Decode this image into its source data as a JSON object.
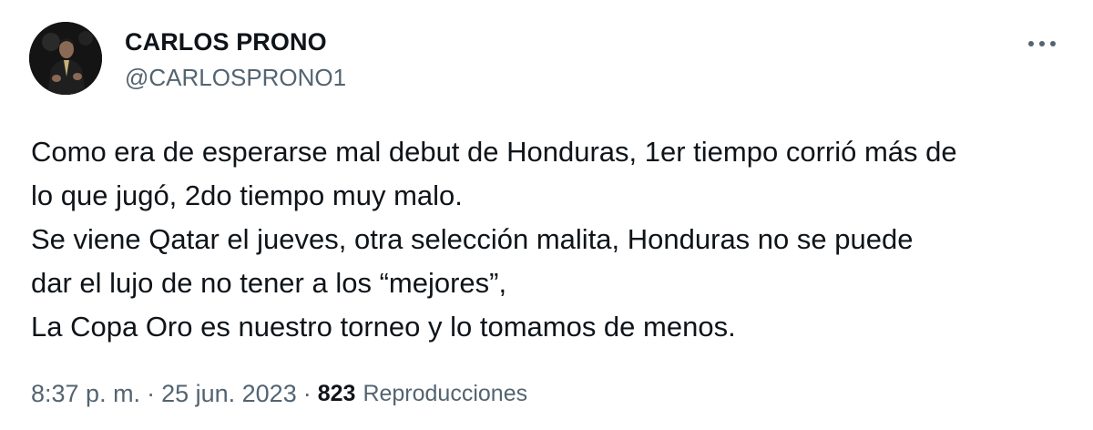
{
  "author": {
    "display_name": "CARLOS PRONO",
    "handle": "@CARLOSPRONO1"
  },
  "tweet": {
    "text": "Como era de esperarse mal debut de Honduras, 1er tiempo corrió más de\nlo que jugó, 2do tiempo muy malo.\nSe viene Qatar el jueves, otra selección malita, Honduras no se puede\ndar el lujo de no tener a los “mejores”,\nLa Copa Oro es nuestro torneo y lo tomamos de menos."
  },
  "meta": {
    "time": "8:37 p. m.",
    "separator": "·",
    "date": "25 jun. 2023",
    "views_count": "823",
    "views_label": "Reproducciones"
  },
  "icons": {
    "more": "more-horizontal-icon"
  },
  "colors": {
    "text_primary": "#0f1419",
    "text_secondary": "#536471",
    "background": "#ffffff"
  }
}
